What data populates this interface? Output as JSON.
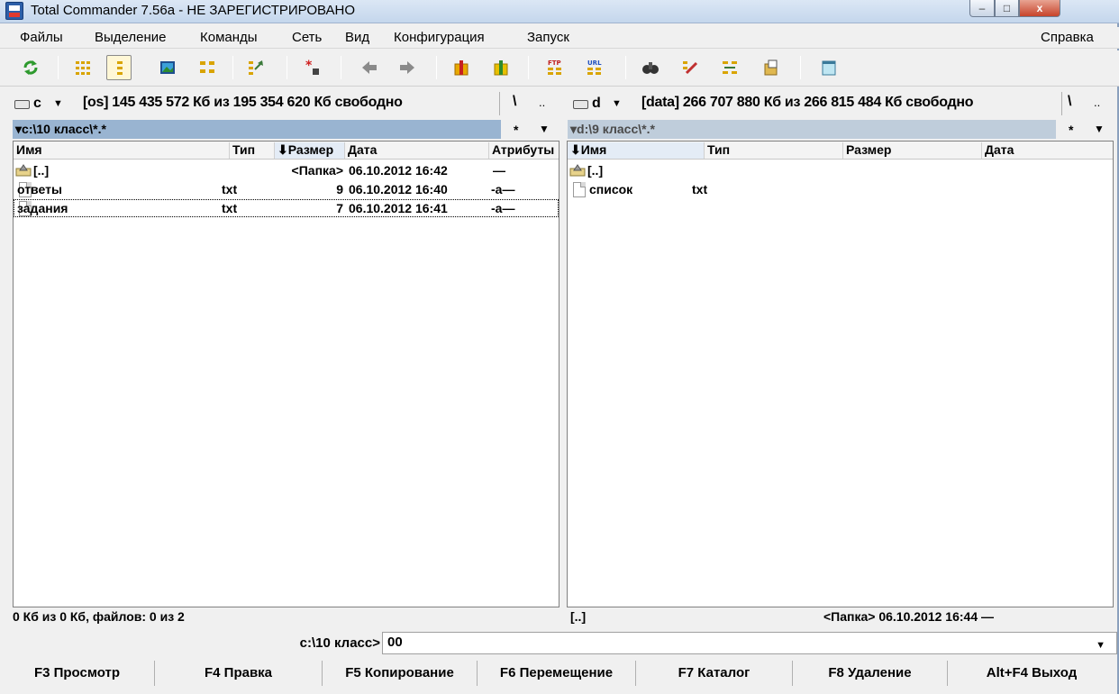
{
  "window": {
    "title": "Total Commander 7.56a - НЕ ЗАРЕГИСТРИРОВАНО",
    "controls": {
      "minimize": "–",
      "maximize": "□",
      "close": "x"
    }
  },
  "menu": [
    "Файлы",
    "Выделение",
    "Команды",
    "Сеть",
    "Вид",
    "Конфигурация",
    "Запуск"
  ],
  "menu_help": "Справка",
  "toolbar_icons": [
    "refresh-icon",
    "brief-view-icon",
    "full-view-icon",
    "thumbnails-icon",
    "tree-view-icon",
    "compare-icon",
    "pack-files-icon",
    "back-icon",
    "forward-icon",
    "archive-pack-icon",
    "archive-unpack-icon",
    "ftp-connect-icon",
    "url-connect-icon",
    "find-files-icon",
    "multi-rename-icon",
    "sync-dirs-icon",
    "copy-names-icon",
    "notepad-icon"
  ],
  "left": {
    "drive": {
      "letter": "c",
      "info": "[os]  145 435 572 Кб из 195 354 620 Кб свободно",
      "root": "\\",
      "up": ".."
    },
    "path": "▾c:\\10 класс\\*.*",
    "filter": "*",
    "columns": [
      "Имя",
      "Тип",
      "⬇Размер",
      "Дата",
      "Атрибуты"
    ],
    "rows": [
      {
        "name": "[..]",
        "type": "",
        "size": "<Папка>",
        "date": "06.10.2012 16:42",
        "attr": "—",
        "icon": "up-dir-icon"
      },
      {
        "name": "ответы",
        "type": "txt",
        "size": "9",
        "date": "06.10.2012 16:40",
        "attr": "-a—",
        "icon": "file-icon"
      },
      {
        "name": "задания",
        "type": "txt",
        "size": "7",
        "date": "06.10.2012 16:41",
        "attr": "-a—",
        "icon": "file-icon"
      }
    ],
    "status": "0 Кб из 0 Кб, файлов: 0 из 2"
  },
  "right": {
    "drive": {
      "letter": "d",
      "info": "[data]  266 707 880 Кб из 266 815 484 Кб свободно",
      "root": "\\",
      "up": ".."
    },
    "path": "▾d:\\9 класс\\*.*",
    "filter": "*",
    "columns": [
      "⬇Имя",
      "Тип",
      "Размер",
      "Дата"
    ],
    "rows": [
      {
        "name": "[..]",
        "type": "",
        "icon": "up-dir-icon"
      },
      {
        "name": "список",
        "type": "txt",
        "icon": "file-icon"
      }
    ],
    "status_name": "[..]",
    "status_info": "<Папка> 06.10.2012 16:44 —"
  },
  "command": {
    "prompt": "c:\\10 класс>",
    "value": "00"
  },
  "fkeys": [
    "F3 Просмотр",
    "F4 Правка",
    "F5 Копирование",
    "F6 Перемещение",
    "F7 Каталог",
    "F8 Удаление",
    "Alt+F4 Выход"
  ]
}
